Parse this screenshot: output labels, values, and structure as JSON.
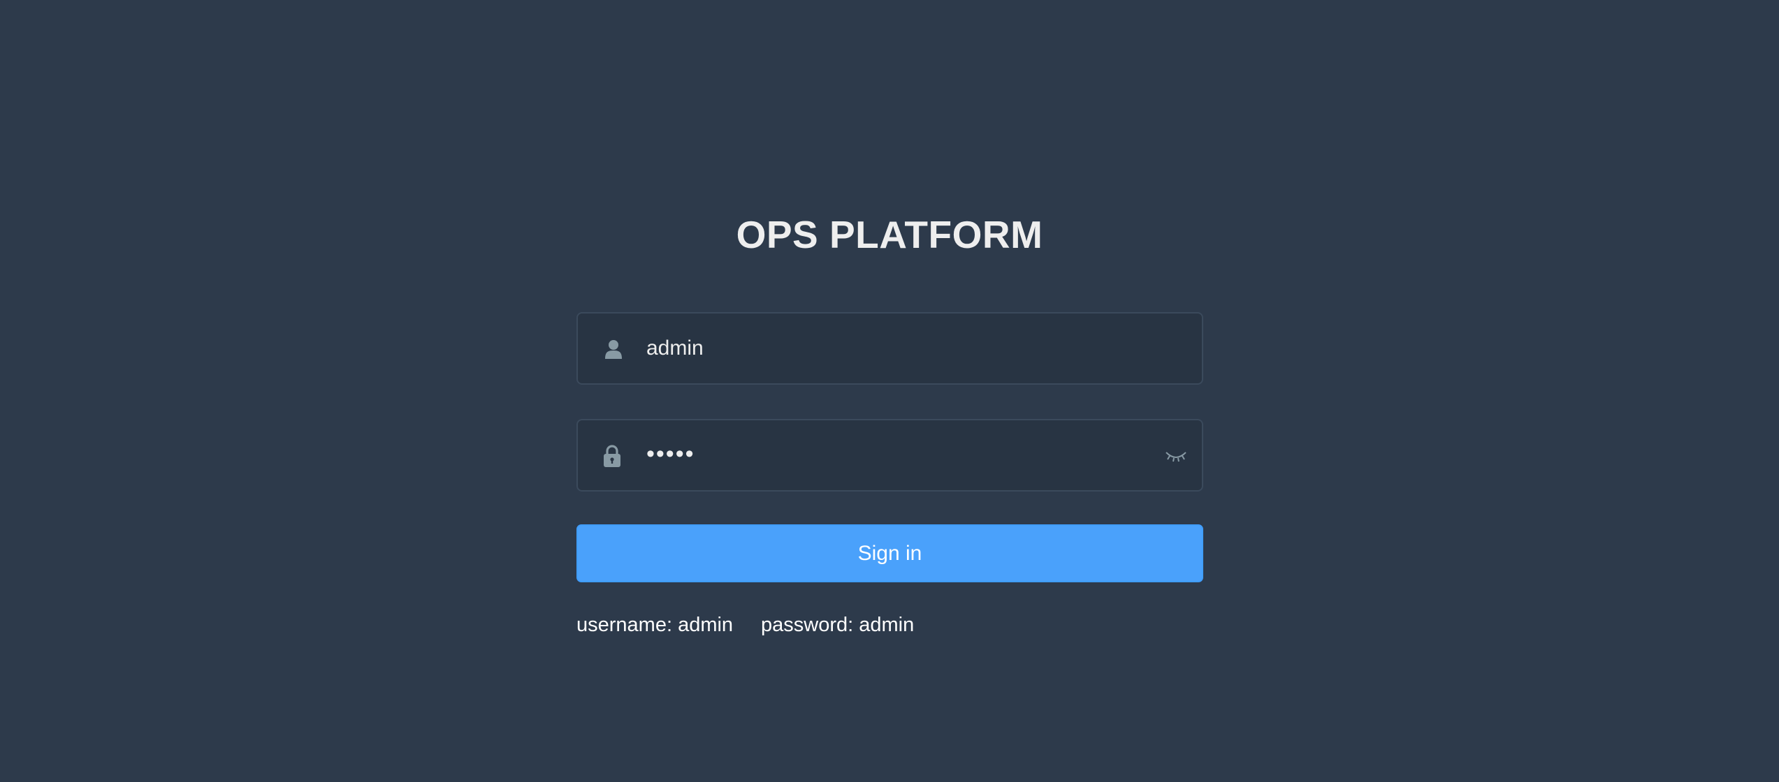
{
  "login": {
    "title": "OPS PLATFORM",
    "username": {
      "value": "admin",
      "icon": "user-icon"
    },
    "password": {
      "value": "•••••",
      "icon": "lock-icon",
      "toggle_icon": "eye-closed-icon"
    },
    "submit_label": "Sign in",
    "tips": {
      "username": "username: admin",
      "password": "password: admin"
    }
  },
  "colors": {
    "background": "#2d3a4b",
    "field_background": "#283443",
    "field_border": "#3b4a5c",
    "button": "#4aa1fb",
    "text": "#eeeeee",
    "icon": "#889aa4"
  }
}
